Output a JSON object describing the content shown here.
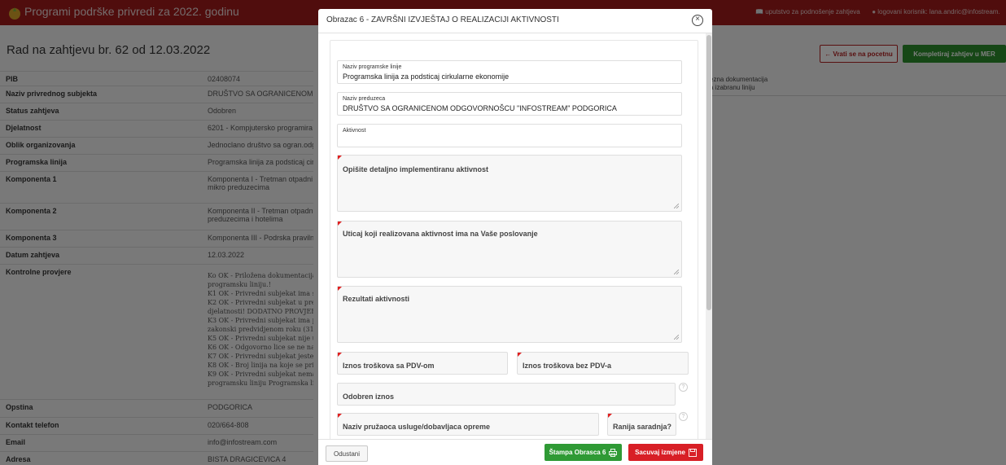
{
  "app": {
    "title": "Programi podrške privredi za 2022. godinu"
  },
  "topbar": {
    "guide_link": "uputstvo za podnošenje zahtjeva",
    "user_label": "logovani korisnik: lana.andric@infostream.",
    "brand_color": "#a11b1b"
  },
  "page": {
    "heading": "Rad na zahtjevu br. 62 od 12.03.2022",
    "back_button": "← Vrati se na pocetnu",
    "complete_button": "Kompletiraj zahtjev u MER",
    "right_note": [
      "ezna dokumentacija",
      "a izabranu liniju"
    ]
  },
  "details": [
    {
      "key": "PIB",
      "value": [
        "02408074"
      ]
    },
    {
      "key": "Naziv privrednog subjekta",
      "value": [
        "DRUŠTVO SA OGRANICENOM O"
      ]
    },
    {
      "key": "Status zahtjeva",
      "value": [
        "Odobren"
      ]
    },
    {
      "key": "Djelatnost",
      "value": [
        "6201 - Kompjutersko programira"
      ]
    },
    {
      "key": "Oblik organizovanja",
      "value": [
        "Jednoclano društvo sa ogran.odg"
      ]
    },
    {
      "key": "Programska linija",
      "value": [
        "Programska linija za podsticaj cir"
      ]
    },
    {
      "key": "Komponenta 1",
      "value": [
        "Komponenta I - Tretman otpadni",
        "mikro preduzecima"
      ]
    },
    {
      "key": "Komponenta 2",
      "value": [
        "Komponenta II - Tretman otpadn",
        "preduzecima i hotelima"
      ]
    },
    {
      "key": "Komponenta 3",
      "value": [
        "Komponenta III - Podrska praviln"
      ]
    },
    {
      "key": "Datum zahtjeva",
      "value": [
        "12.03.2022"
      ]
    },
    {
      "key": "Kontrolne provjere",
      "value": [
        "Ko OK - Priložena dokumentacija j",
        "programsku liniju.!",
        "K1 OK - Privredni subjekat ima sjed",
        "K2 OK - Privredni subjekat u prethe",
        "djelatnosti! DODATNO PROVJERI",
        "K3 OK - Privredni subjekat ima pre",
        "zakonski predvidjenom roku (31.03",
        "K5 OK - Privredni subjekat nije u p",
        "K6 OK - Odgovorno lice se ne nalaz",
        "K7 OK - Privredni subjekat jeste mi",
        "K8 OK - Broj linija na koje se prijav",
        "K9 OK - Privredni subjekat nema d",
        "programsku liniju Programska linij"
      ]
    },
    {
      "key": "Opstina",
      "value": [
        "PODGORICA"
      ]
    },
    {
      "key": "Kontakt telefon",
      "value": [
        "020/664-808"
      ]
    },
    {
      "key": "Email",
      "value": [
        "info@infostream.com"
      ]
    },
    {
      "key": "Adresa",
      "value": [
        "BISTA DRAGICEVICA 4"
      ]
    }
  ],
  "modal": {
    "title": "Obrazac 6 - ZAVRŠNI IZVJEŠTAJ O REALIZACIJI AKTIVNOSTI",
    "fields": {
      "programska_linija": {
        "label": "Naziv programske linije",
        "value": "Programska linija za podsticaj cirkularne ekonomije"
      },
      "preduzece": {
        "label": "Naziv preduzeca",
        "value": "DRUŠTVO SA OGRANICENOM ODGOVORNOŠCU \"INFOSTREAM\" PODGORICA"
      },
      "aktivnost": {
        "label": "Aktivnost",
        "value": ""
      },
      "opis": {
        "label": "Opišite detaljno implementiranu aktivnost",
        "value": ""
      },
      "uticaj": {
        "label": "Uticaj koji realizovana aktivnost ima na Vaše poslovanje",
        "value": ""
      },
      "rezultati": {
        "label": "Rezultati aktivnosti",
        "value": ""
      },
      "iznos_sa_pdv": {
        "label": "Iznos troškova sa PDV-om",
        "value": ""
      },
      "iznos_bez_pdv": {
        "label": "Iznos troškova bez PDV-a",
        "value": ""
      },
      "odobren_iznos": {
        "label": "Odobren iznos",
        "value": ""
      },
      "pruzalac": {
        "label": "Naziv pružaoca usluge/dobavljaca opreme",
        "value": ""
      },
      "ranija_saradnja": {
        "label": "Ranija saradnja?",
        "value": ""
      }
    },
    "help_glyph": "?",
    "buttons": {
      "cancel": "Odustani",
      "print": "Štampa Obrasca 6",
      "save": "Sacuvaj izmjene"
    },
    "colors": {
      "print": "#2f9a35",
      "save": "#d81f26",
      "required_marker": "#e02020"
    }
  }
}
